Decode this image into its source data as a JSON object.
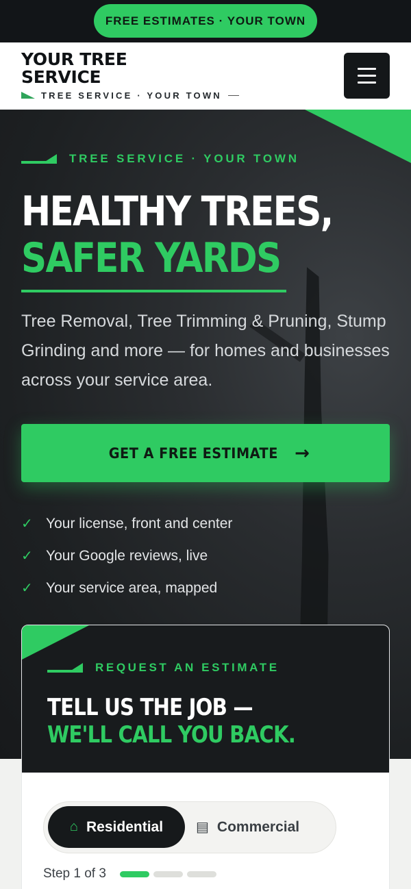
{
  "topbar": {
    "pill_label": "FREE ESTIMATES · YOUR TOWN"
  },
  "header": {
    "logo_line1": "YOUR TREE",
    "logo_line2": "SERVICE",
    "tagline": "TREE SERVICE · YOUR TOWN",
    "menu_icon": "hamburger-menu-icon"
  },
  "hero": {
    "eyebrow": "TREE SERVICE · YOUR TOWN",
    "headline_line1": "HEALTHY TREES,",
    "headline_line2": "SAFER YARDS",
    "description": "Tree Removal, Tree Trimming & Pruning, Stump Grinding and more — for homes and businesses across your service area.",
    "cta_label": "GET A FREE ESTIMATE",
    "cta_icon": "arrow-right-icon",
    "checks": [
      {
        "icon": "check-icon",
        "text": "Your license, front and center"
      },
      {
        "icon": "check-icon",
        "text": "Your Google reviews, live"
      },
      {
        "icon": "check-icon",
        "text": "Your service area, mapped"
      }
    ]
  },
  "estimate_card": {
    "eyebrow": "REQUEST AN ESTIMATE",
    "title_line1": "TELL US THE JOB —",
    "title_line2": "WE'LL CALL YOU BACK.",
    "segments": [
      {
        "label": "Residential",
        "icon": "home-icon",
        "selected": true
      },
      {
        "label": "Commercial",
        "icon": "building-icon",
        "selected": false
      }
    ],
    "step_label": "Step 1 of 3",
    "step_current": 1,
    "step_total": 3
  },
  "colors": {
    "accent": "#2fcb62",
    "dark": "#16191b",
    "topbar": "#121518"
  }
}
